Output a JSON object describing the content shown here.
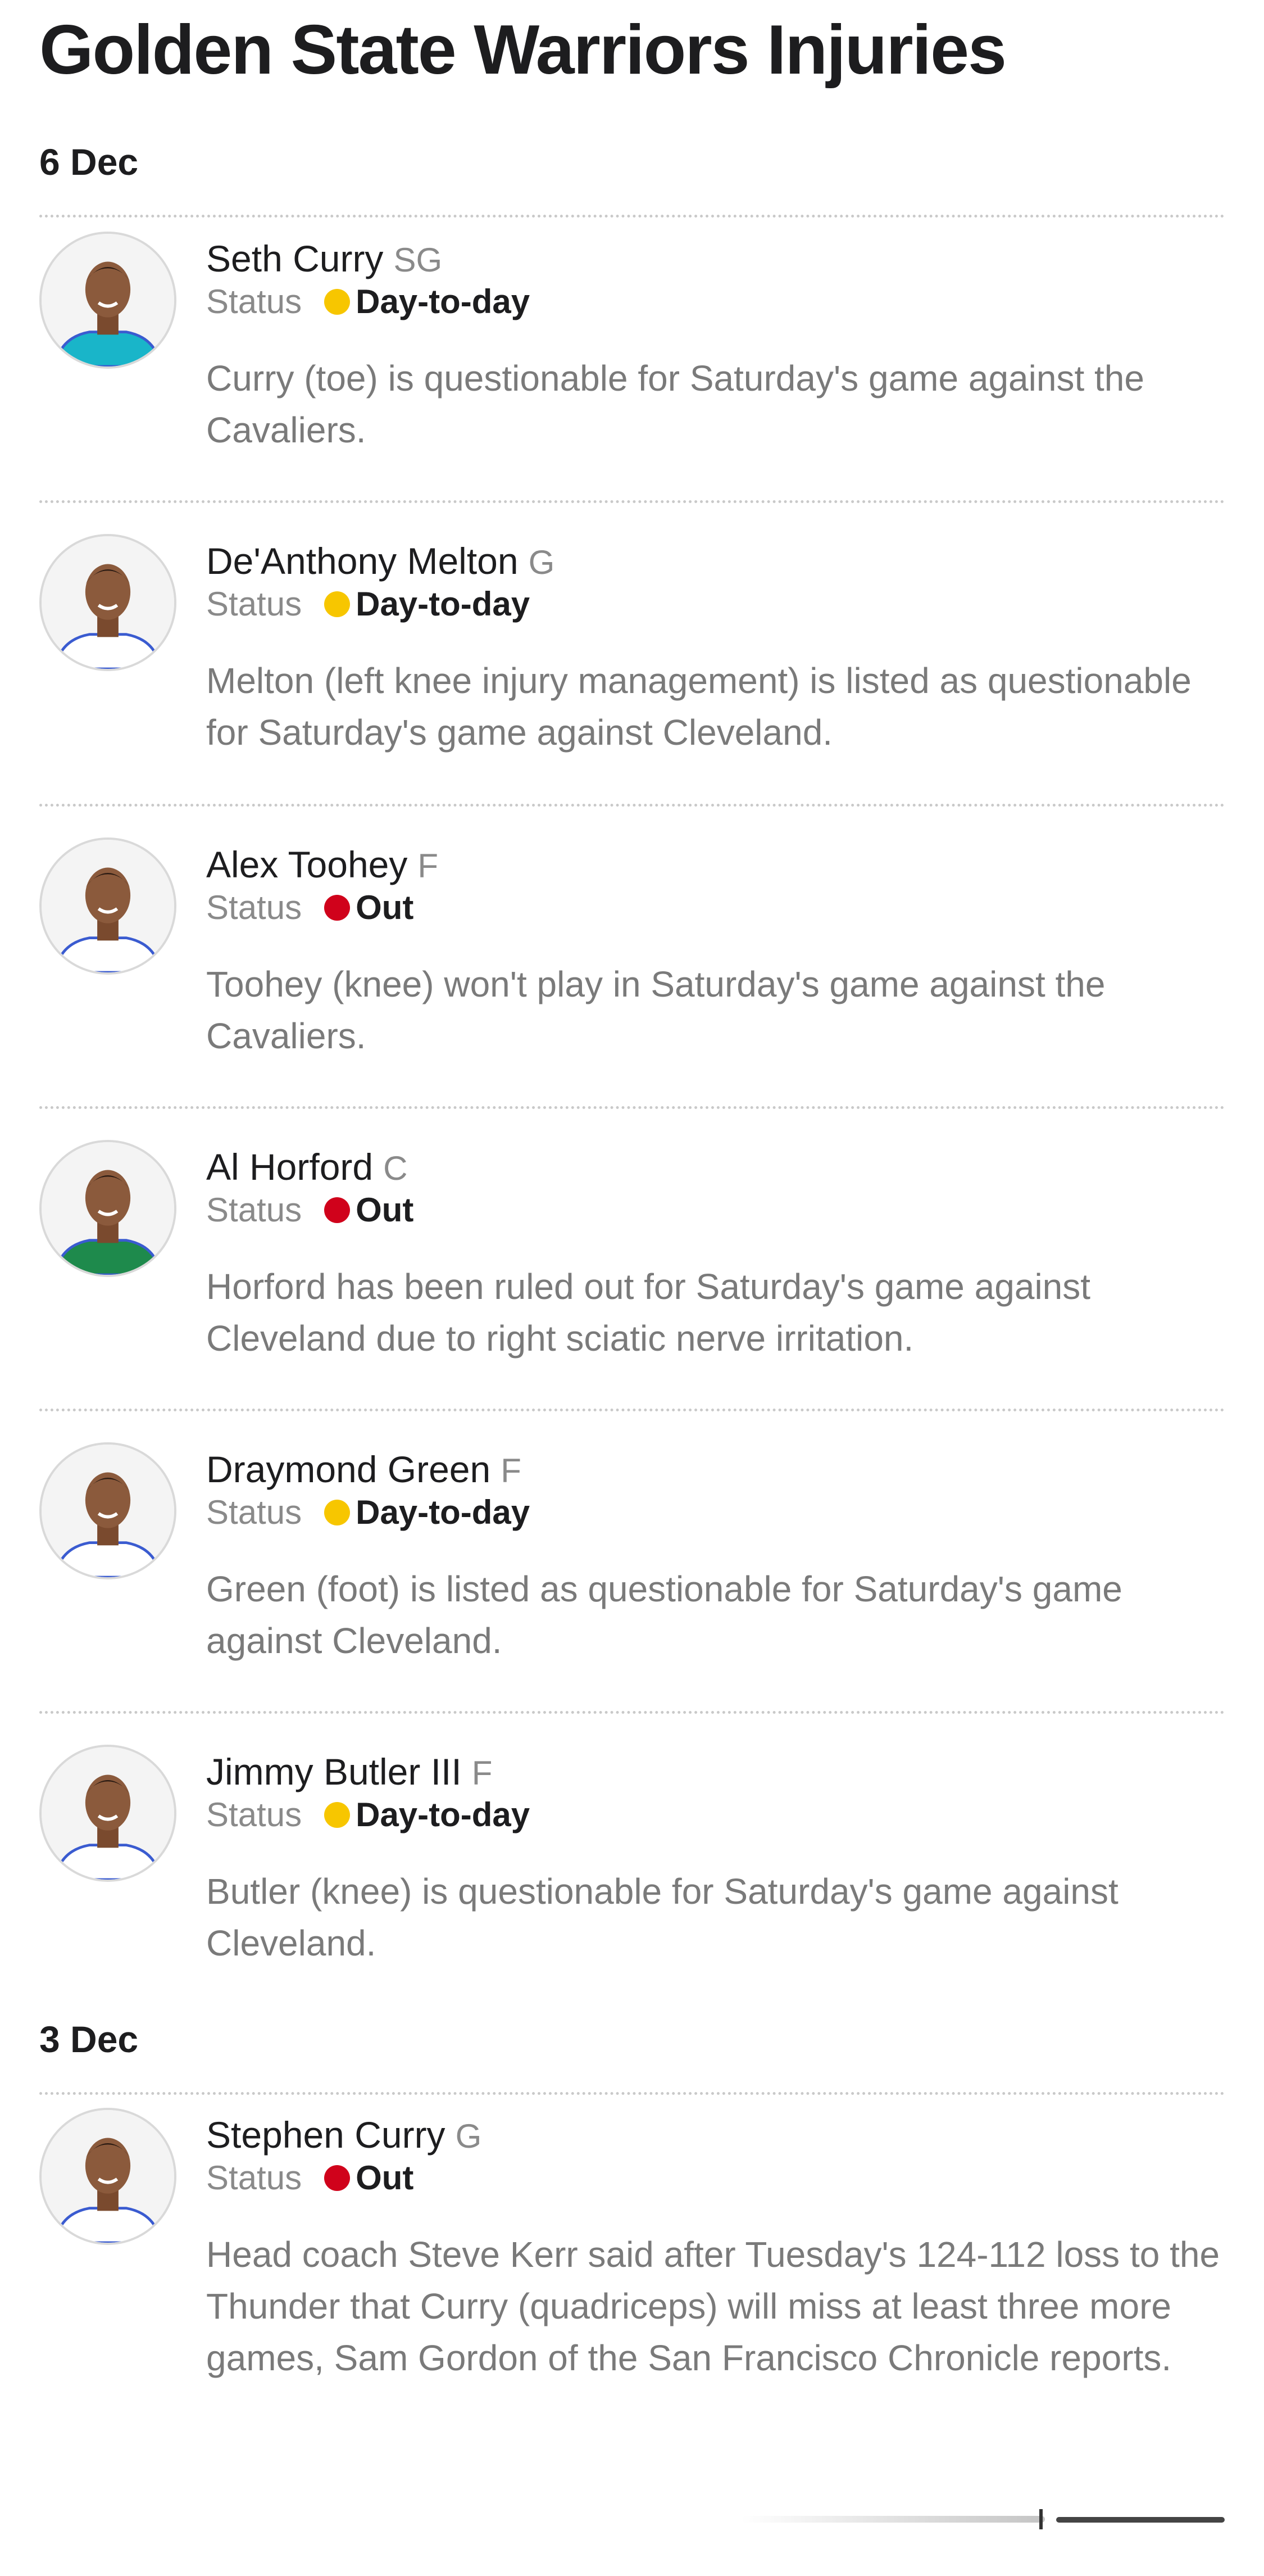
{
  "page_title": "Golden State Warriors Injuries",
  "status_label": "Status",
  "colors": {
    "day_to_day": "#f7c600",
    "out": "#d0021b"
  },
  "groups": [
    {
      "date": "6 Dec",
      "players": [
        {
          "name": "Seth Curry",
          "position": "SG",
          "status": "Day-to-day",
          "jersey": "teal",
          "note": "Curry (toe) is questionable for Saturday's game against the Cavaliers."
        },
        {
          "name": "De'Anthony Melton",
          "position": "G",
          "status": "Day-to-day",
          "jersey": "white",
          "note": "Melton (left knee injury management) is listed as questionable for Saturday's game against Cleveland."
        },
        {
          "name": "Alex Toohey",
          "position": "F",
          "status": "Out",
          "jersey": "white",
          "note": "Toohey (knee) won't play in Saturday's game against the Cavaliers."
        },
        {
          "name": "Al Horford",
          "position": "C",
          "status": "Out",
          "jersey": "green",
          "note": "Horford has been ruled out for Saturday's game against Cleveland due to right sciatic nerve irritation."
        },
        {
          "name": "Draymond Green",
          "position": "F",
          "status": "Day-to-day",
          "jersey": "white",
          "note": "Green (foot) is listed as questionable for Saturday's game against Cleveland."
        },
        {
          "name": "Jimmy Butler III",
          "position": "F",
          "status": "Day-to-day",
          "jersey": "white",
          "note": "Butler (knee) is questionable for Saturday's game against Cleveland."
        }
      ]
    },
    {
      "date": "3 Dec",
      "players": [
        {
          "name": "Stephen Curry",
          "position": "G",
          "status": "Out",
          "jersey": "white",
          "note": "Head coach Steve Kerr said after Tuesday's 124-112 loss to the Thunder that Curry (quadriceps) will miss at least three more games, Sam Gordon of the San Francisco Chronicle reports."
        }
      ]
    }
  ]
}
